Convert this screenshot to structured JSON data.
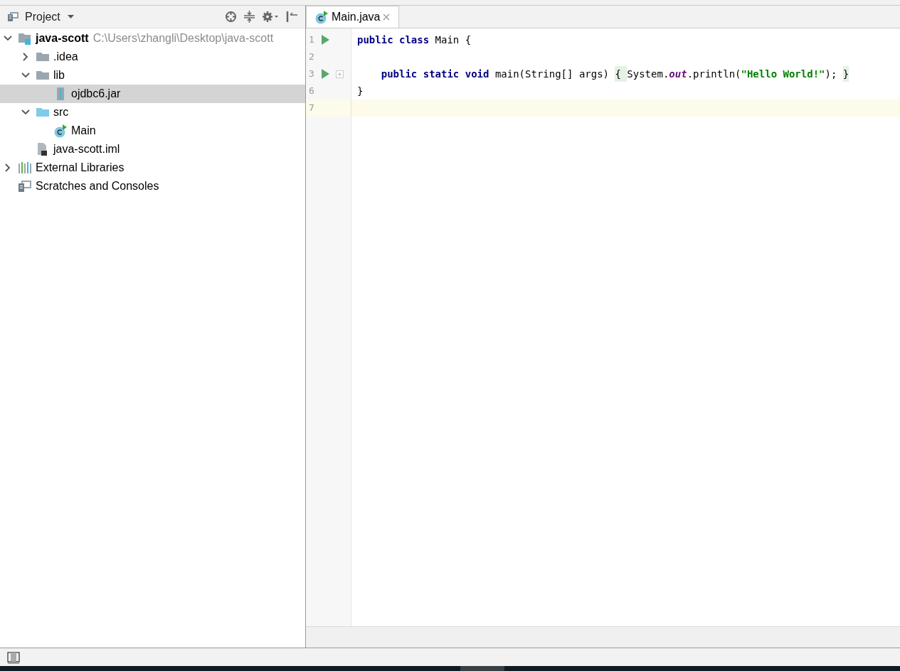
{
  "project_panel": {
    "title": "Project",
    "toolbar": [
      {
        "kind": "locate"
      },
      {
        "kind": "collapse"
      },
      {
        "kind": "settings"
      },
      {
        "kind": "hide"
      }
    ],
    "tree": [
      {
        "label": "java-scott",
        "kind": "module",
        "path": "C:\\Users\\zhangli\\Desktop\\java-scott",
        "expanded": true,
        "selected": false,
        "children": [
          {
            "label": ".idea",
            "kind": "folder",
            "expanded": false,
            "selected": false
          },
          {
            "label": "lib",
            "kind": "folder",
            "expanded": true,
            "selected": false,
            "children": [
              {
                "label": "ojdbc6.jar",
                "kind": "jar",
                "selected": true
              }
            ]
          },
          {
            "label": "src",
            "kind": "source-folder",
            "expanded": true,
            "selected": false,
            "children": [
              {
                "label": "Main",
                "kind": "class",
                "selected": false
              }
            ]
          },
          {
            "label": "java-scott.iml",
            "kind": "iml",
            "selected": false
          }
        ]
      },
      {
        "label": "External Libraries",
        "kind": "libraries",
        "expanded": false,
        "selected": false
      },
      {
        "label": "Scratches and Consoles",
        "kind": "scratches",
        "selected": false
      }
    ]
  },
  "editor": {
    "tabs": [
      {
        "label": "Main.java",
        "selected": true
      }
    ],
    "lines": [
      {
        "number": "1",
        "run": true,
        "fold": false,
        "current": false,
        "tokens": [
          {
            "text": "public class ",
            "kind": "keyword"
          },
          {
            "text": "Main {",
            "kind": "plain"
          }
        ]
      },
      {
        "number": "2",
        "run": false,
        "fold": false,
        "current": false
      },
      {
        "number": "3",
        "run": true,
        "fold": true,
        "current": false,
        "tokens": [
          {
            "text": "    public static void ",
            "kind": "keyword"
          },
          {
            "text": "main(String[] args) ",
            "kind": "plain"
          },
          {
            "text": "{ ",
            "kind": "folded"
          },
          {
            "text": "System.",
            "kind": "plain"
          },
          {
            "text": "out",
            "kind": "field"
          },
          {
            "text": ".println(",
            "kind": "plain"
          },
          {
            "text": "\"Hello World!\"",
            "kind": "string"
          },
          {
            "text": "); ",
            "kind": "plain"
          },
          {
            "text": "}",
            "kind": "folded"
          }
        ]
      },
      {
        "number": "6",
        "run": false,
        "fold": false,
        "current": false,
        "tokens": [
          {
            "text": "}",
            "kind": "plain"
          }
        ]
      },
      {
        "number": "7",
        "run": false,
        "fold": false,
        "current": true
      }
    ]
  }
}
